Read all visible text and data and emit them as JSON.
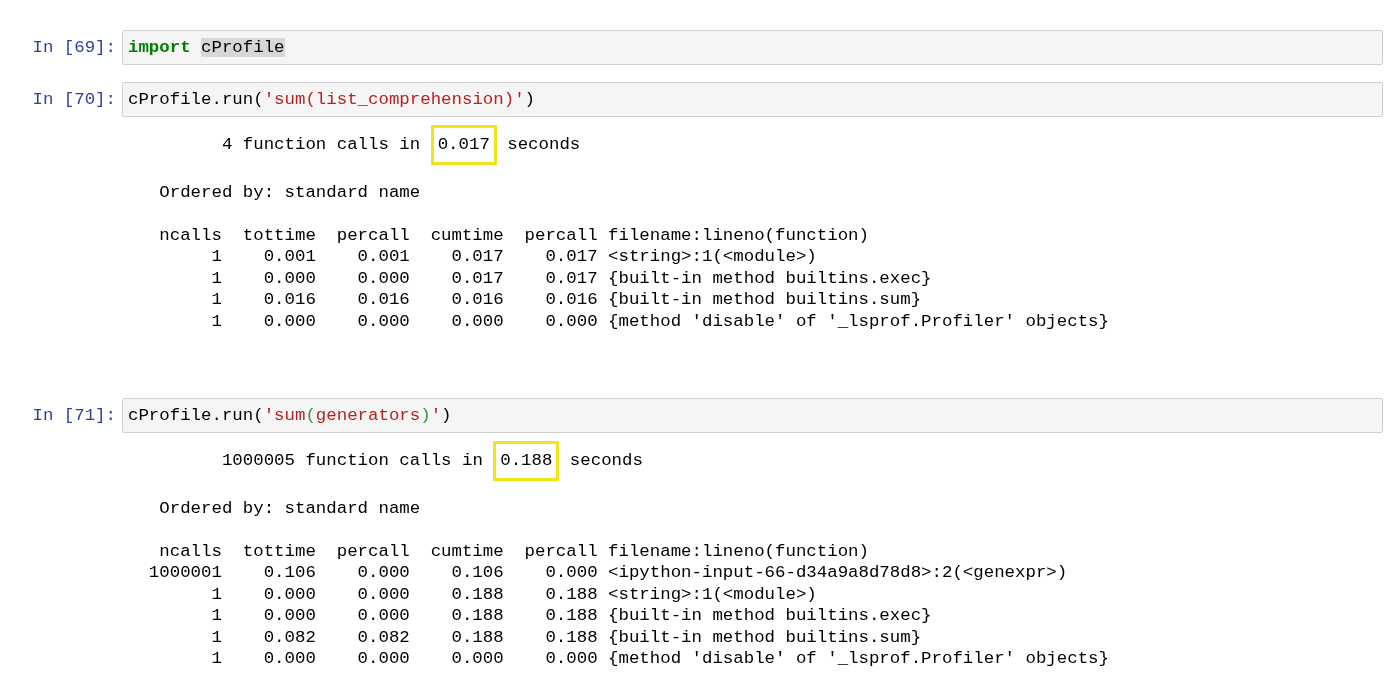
{
  "cells": [
    {
      "prompt": "In [69]:",
      "code": [
        {
          "kind": "keyword",
          "text": "import "
        },
        {
          "kind": "match",
          "text": "cProfile"
        }
      ]
    },
    {
      "prompt": "In [70]:",
      "code": [
        {
          "kind": "plain",
          "text": "cProfile.run("
        },
        {
          "kind": "string",
          "text": "'sum(list_comprehension)'"
        },
        {
          "kind": "plain",
          "text": ")"
        }
      ],
      "output": {
        "summary": {
          "before": "4 function calls in",
          "value": "0.017",
          "after": "seconds"
        },
        "ordered_by": "Ordered by: standard name",
        "columns": [
          "ncalls",
          "tottime",
          "percall",
          "cumtime",
          "percall",
          "filename:lineno(function)"
        ],
        "rows": [
          [
            "1",
            "0.001",
            "0.001",
            "0.017",
            "0.017",
            "<string>:1(<module>)"
          ],
          [
            "1",
            "0.000",
            "0.000",
            "0.017",
            "0.017",
            "{built-in method builtins.exec}"
          ],
          [
            "1",
            "0.016",
            "0.016",
            "0.016",
            "0.016",
            "{built-in method builtins.sum}"
          ],
          [
            "1",
            "0.000",
            "0.000",
            "0.000",
            "0.000",
            "{method 'disable' of '_lsprof.Profiler' objects}"
          ]
        ]
      }
    },
    {
      "prompt": "In [71]:",
      "code": [
        {
          "kind": "plain",
          "text": "cProfile.run("
        },
        {
          "kind": "string",
          "text": "'sum"
        },
        {
          "kind": "paren",
          "text": "("
        },
        {
          "kind": "string",
          "text": "generators"
        },
        {
          "kind": "paren",
          "text": ")"
        },
        {
          "kind": "string",
          "text": "'"
        },
        {
          "kind": "plain",
          "text": ")"
        }
      ],
      "output": {
        "summary": {
          "before": "1000005 function calls in",
          "value": "0.188",
          "after": "seconds"
        },
        "ordered_by": "Ordered by: standard name",
        "columns": [
          "ncalls",
          "tottime",
          "percall",
          "cumtime",
          "percall",
          "filename:lineno(function)"
        ],
        "rows": [
          [
            "1000001",
            "0.106",
            "0.000",
            "0.106",
            "0.000",
            "<ipython-input-66-d34a9a8d78d8>:2(<genexpr>)"
          ],
          [
            "1",
            "0.000",
            "0.000",
            "0.188",
            "0.188",
            "<string>:1(<module>)"
          ],
          [
            "1",
            "0.000",
            "0.000",
            "0.188",
            "0.188",
            "{built-in method builtins.exec}"
          ],
          [
            "1",
            "0.082",
            "0.082",
            "0.188",
            "0.188",
            "{built-in method builtins.sum}"
          ],
          [
            "1",
            "0.000",
            "0.000",
            "0.000",
            "0.000",
            "{method 'disable' of '_lsprof.Profiler' objects}"
          ]
        ]
      }
    }
  ]
}
